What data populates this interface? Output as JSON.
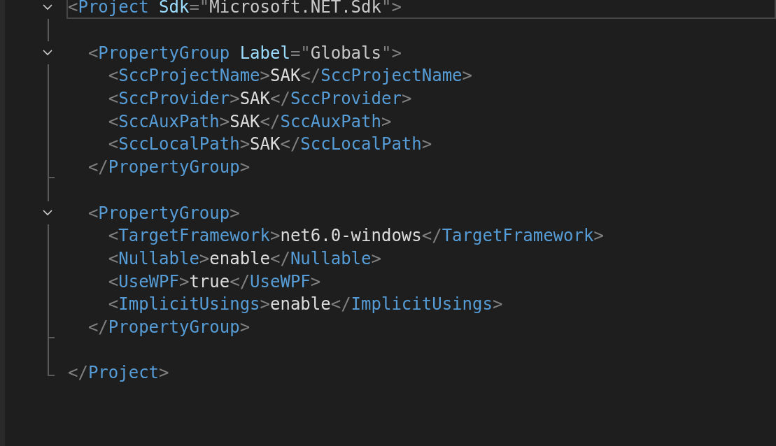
{
  "editor": {
    "lines": [
      {
        "collapsible": true,
        "fold_end": false,
        "selected": true,
        "tokens": [
          {
            "kind": "punct",
            "text": "<"
          },
          {
            "kind": "tag",
            "text": "Project"
          },
          {
            "kind": "attr",
            "text": " Sdk"
          },
          {
            "kind": "punct",
            "text": "=\""
          },
          {
            "kind": "value",
            "text": "Microsoft.NET.Sdk"
          },
          {
            "kind": "punct",
            "text": "\">"
          }
        ]
      },
      {
        "collapsible": false,
        "fold_end": false,
        "selected": false
      },
      {
        "collapsible": true,
        "fold_end": false,
        "selected": false,
        "tokens": [
          {
            "kind": "punct",
            "text": "  <"
          },
          {
            "kind": "tag",
            "text": "PropertyGroup"
          },
          {
            "kind": "attr",
            "text": " Label"
          },
          {
            "kind": "punct",
            "text": "=\""
          },
          {
            "kind": "value",
            "text": "Globals"
          },
          {
            "kind": "punct",
            "text": "\">"
          }
        ]
      },
      {
        "collapsible": false,
        "fold_end": false,
        "selected": false,
        "tokens": [
          {
            "kind": "punct",
            "text": "    <"
          },
          {
            "kind": "tag",
            "text": "SccProjectName"
          },
          {
            "kind": "punct",
            "text": ">"
          },
          {
            "kind": "text",
            "text": "SAK"
          },
          {
            "kind": "punct",
            "text": "</"
          },
          {
            "kind": "tag",
            "text": "SccProjectName"
          },
          {
            "kind": "punct",
            "text": ">"
          }
        ]
      },
      {
        "collapsible": false,
        "fold_end": false,
        "selected": false,
        "tokens": [
          {
            "kind": "punct",
            "text": "    <"
          },
          {
            "kind": "tag",
            "text": "SccProvider"
          },
          {
            "kind": "punct",
            "text": ">"
          },
          {
            "kind": "text",
            "text": "SAK"
          },
          {
            "kind": "punct",
            "text": "</"
          },
          {
            "kind": "tag",
            "text": "SccProvider"
          },
          {
            "kind": "punct",
            "text": ">"
          }
        ]
      },
      {
        "collapsible": false,
        "fold_end": false,
        "selected": false,
        "tokens": [
          {
            "kind": "punct",
            "text": "    <"
          },
          {
            "kind": "tag",
            "text": "SccAuxPath"
          },
          {
            "kind": "punct",
            "text": ">"
          },
          {
            "kind": "text",
            "text": "SAK"
          },
          {
            "kind": "punct",
            "text": "</"
          },
          {
            "kind": "tag",
            "text": "SccAuxPath"
          },
          {
            "kind": "punct",
            "text": ">"
          }
        ]
      },
      {
        "collapsible": false,
        "fold_end": false,
        "selected": false,
        "tokens": [
          {
            "kind": "punct",
            "text": "    <"
          },
          {
            "kind": "tag",
            "text": "SccLocalPath"
          },
          {
            "kind": "punct",
            "text": ">"
          },
          {
            "kind": "text",
            "text": "SAK"
          },
          {
            "kind": "punct",
            "text": "</"
          },
          {
            "kind": "tag",
            "text": "SccLocalPath"
          },
          {
            "kind": "punct",
            "text": ">"
          }
        ]
      },
      {
        "collapsible": false,
        "fold_end": true,
        "selected": false,
        "tokens": [
          {
            "kind": "punct",
            "text": "  </"
          },
          {
            "kind": "tag",
            "text": "PropertyGroup"
          },
          {
            "kind": "punct",
            "text": ">"
          }
        ]
      },
      {
        "collapsible": false,
        "fold_end": false,
        "selected": false
      },
      {
        "collapsible": true,
        "fold_end": false,
        "selected": false,
        "tokens": [
          {
            "kind": "punct",
            "text": "  <"
          },
          {
            "kind": "tag",
            "text": "PropertyGroup"
          },
          {
            "kind": "punct",
            "text": ">"
          }
        ]
      },
      {
        "collapsible": false,
        "fold_end": false,
        "selected": false,
        "tokens": [
          {
            "kind": "punct",
            "text": "    <"
          },
          {
            "kind": "tag",
            "text": "TargetFramework"
          },
          {
            "kind": "punct",
            "text": ">"
          },
          {
            "kind": "text",
            "text": "net6.0-windows"
          },
          {
            "kind": "punct",
            "text": "</"
          },
          {
            "kind": "tag",
            "text": "TargetFramework"
          },
          {
            "kind": "punct",
            "text": ">"
          }
        ]
      },
      {
        "collapsible": false,
        "fold_end": false,
        "selected": false,
        "tokens": [
          {
            "kind": "punct",
            "text": "    <"
          },
          {
            "kind": "tag",
            "text": "Nullable"
          },
          {
            "kind": "punct",
            "text": ">"
          },
          {
            "kind": "text",
            "text": "enable"
          },
          {
            "kind": "punct",
            "text": "</"
          },
          {
            "kind": "tag",
            "text": "Nullable"
          },
          {
            "kind": "punct",
            "text": ">"
          }
        ]
      },
      {
        "collapsible": false,
        "fold_end": false,
        "selected": false,
        "tokens": [
          {
            "kind": "punct",
            "text": "    <"
          },
          {
            "kind": "tag",
            "text": "UseWPF"
          },
          {
            "kind": "punct",
            "text": ">"
          },
          {
            "kind": "text",
            "text": "true"
          },
          {
            "kind": "punct",
            "text": "</"
          },
          {
            "kind": "tag",
            "text": "UseWPF"
          },
          {
            "kind": "punct",
            "text": ">"
          }
        ]
      },
      {
        "collapsible": false,
        "fold_end": false,
        "selected": false,
        "tokens": [
          {
            "kind": "punct",
            "text": "    <"
          },
          {
            "kind": "tag",
            "text": "ImplicitUsings"
          },
          {
            "kind": "punct",
            "text": ">"
          },
          {
            "kind": "text",
            "text": "enable"
          },
          {
            "kind": "punct",
            "text": "</"
          },
          {
            "kind": "tag",
            "text": "ImplicitUsings"
          },
          {
            "kind": "punct",
            "text": ">"
          }
        ]
      },
      {
        "collapsible": false,
        "fold_end": true,
        "selected": false,
        "tokens": [
          {
            "kind": "punct",
            "text": "  </"
          },
          {
            "kind": "tag",
            "text": "PropertyGroup"
          },
          {
            "kind": "punct",
            "text": ">"
          }
        ]
      },
      {
        "collapsible": false,
        "fold_end": false,
        "selected": false
      },
      {
        "collapsible": false,
        "fold_end": true,
        "selected": false,
        "tokens": [
          {
            "kind": "punct",
            "text": "</"
          },
          {
            "kind": "tag",
            "text": "Project"
          },
          {
            "kind": "punct",
            "text": ">"
          }
        ]
      }
    ]
  }
}
